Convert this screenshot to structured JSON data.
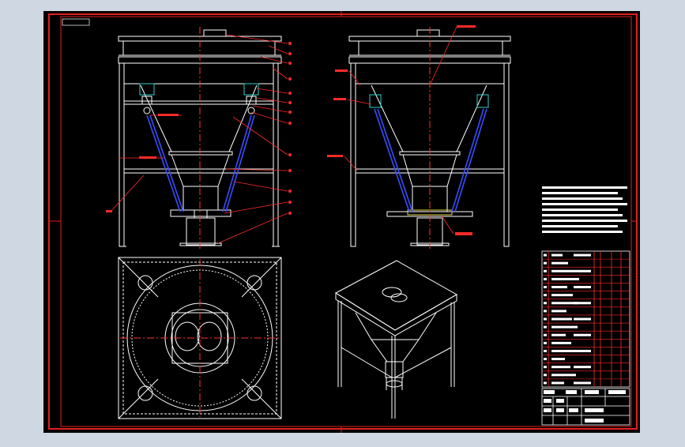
{
  "page_bg": "#cfd7e2",
  "sheet_bg": "#000000",
  "colors": {
    "frame": "#e02020",
    "line": "#ffffff",
    "center": "#ff3030",
    "leader": "#ff2a2a",
    "blue": "#3a4dff",
    "cyan": "#2fd0c8",
    "yellow": "#e8d84a"
  },
  "views": {
    "front": "front-elevation",
    "side": "side-elevation",
    "top": "top-plan",
    "iso": "isometric"
  },
  "balloons": [
    "1",
    "2",
    "3",
    "4",
    "5",
    "6",
    "7",
    "8",
    "9",
    "10",
    "11",
    "12",
    "13",
    "14",
    "15"
  ],
  "tech_requirements_lines": 9,
  "parts_list_rows": 17
}
